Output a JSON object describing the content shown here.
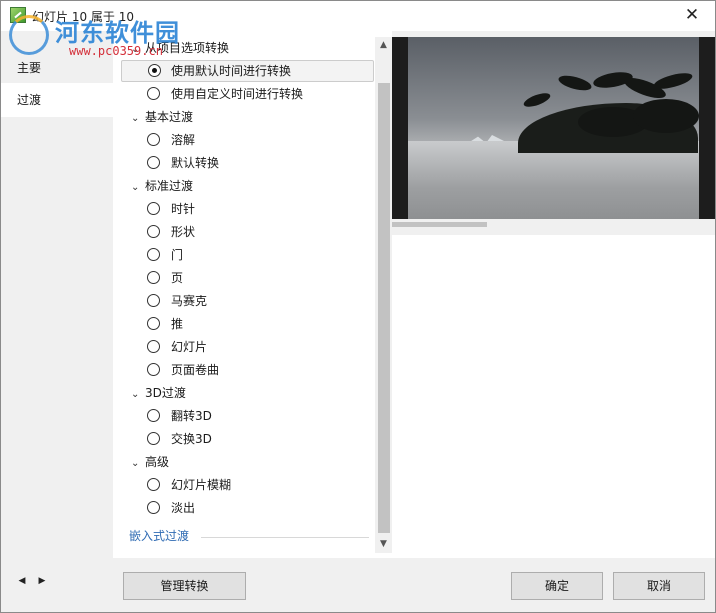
{
  "window": {
    "title": "幻灯片 10 属于 10",
    "close_glyph": "✕"
  },
  "watermark": {
    "site_name": "河东软件园",
    "url": "www.pc0359.cn"
  },
  "nav": {
    "items": [
      {
        "label": "主要",
        "active": false
      },
      {
        "label": "过渡",
        "active": true
      }
    ]
  },
  "transitions": {
    "groups": [
      {
        "label": "从项目选项转换",
        "options": [
          {
            "label": "使用默认时间进行转换",
            "checked": true,
            "highlighted": true
          },
          {
            "label": "使用自定义时间进行转换",
            "checked": false
          }
        ]
      },
      {
        "label": "基本过渡",
        "options": [
          {
            "label": "溶解",
            "checked": false
          },
          {
            "label": "默认转换",
            "checked": false
          }
        ]
      },
      {
        "label": "标准过渡",
        "options": [
          {
            "label": "时针",
            "checked": false
          },
          {
            "label": "形状",
            "checked": false
          },
          {
            "label": "门",
            "checked": false
          },
          {
            "label": "页",
            "checked": false
          },
          {
            "label": "马赛克",
            "checked": false
          },
          {
            "label": "推",
            "checked": false
          },
          {
            "label": "幻灯片",
            "checked": false
          },
          {
            "label": "页面卷曲",
            "checked": false
          }
        ]
      },
      {
        "label": "3D过渡",
        "options": [
          {
            "label": "翻转3D",
            "checked": false
          },
          {
            "label": "交换3D",
            "checked": false
          }
        ]
      },
      {
        "label": "高级",
        "options": [
          {
            "label": "幻灯片模糊",
            "checked": false
          },
          {
            "label": "淡出",
            "checked": false
          }
        ]
      }
    ],
    "embedded_section": "嵌入式过渡"
  },
  "icons": {
    "chevron": "chevron-down-icon",
    "scroll_up": "scroll-up-arrow-icon",
    "scroll_down": "scroll-down-arrow-icon",
    "prev": "arrow-left-icon",
    "next": "arrow-right-icon"
  },
  "buttons": {
    "manage": "管理转换",
    "ok": "确定",
    "cancel": "取消"
  },
  "colors": {
    "link_blue": "#2f6bb3",
    "watermark_blue": "#2f86d6",
    "watermark_red": "#d4303a"
  }
}
